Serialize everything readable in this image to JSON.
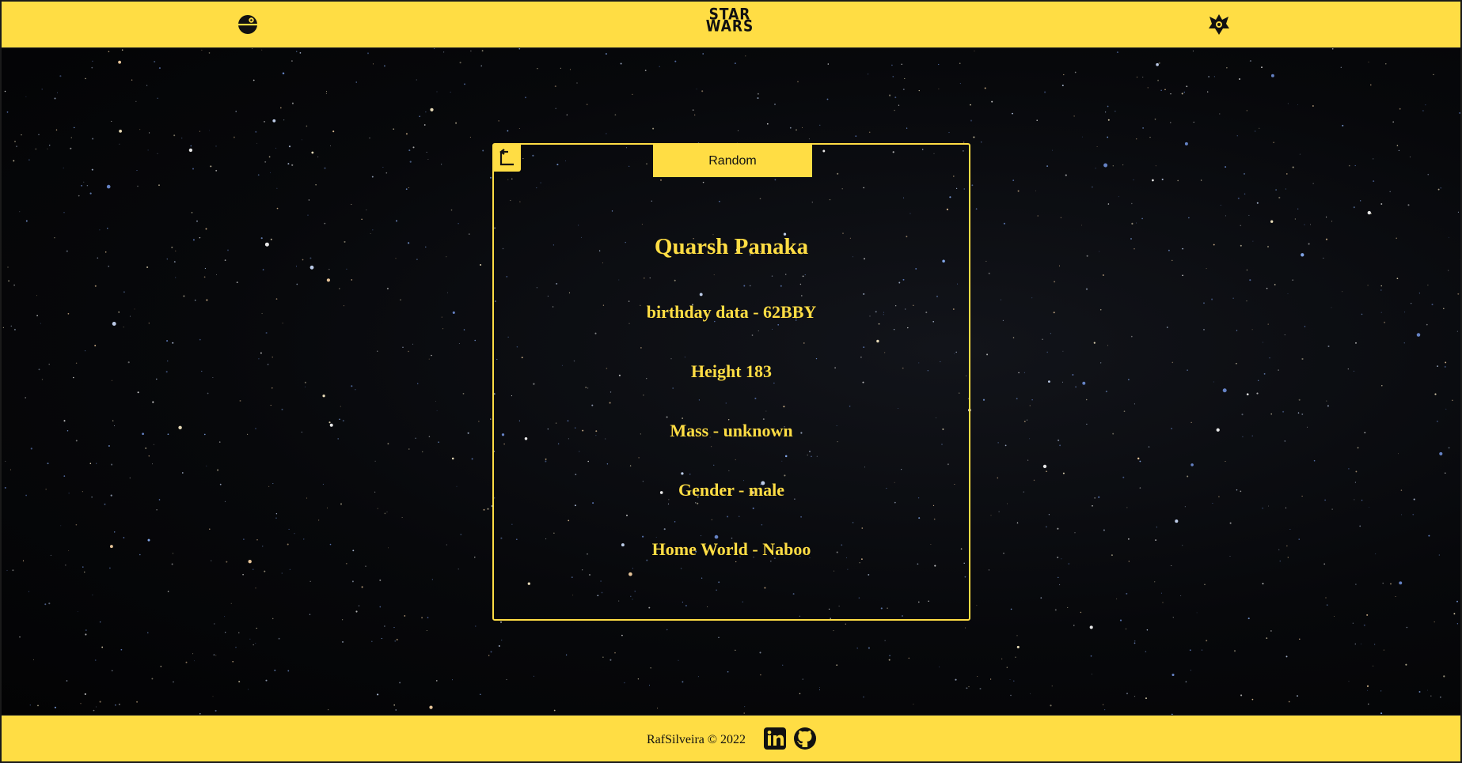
{
  "header": {
    "logo_line1": "STAR",
    "logo_line2": "WARS",
    "left_icon": "death-star-icon",
    "right_icon": "galactic-empire-icon"
  },
  "card": {
    "back_icon": "return-arrow-icon",
    "random_label": "Random",
    "name": "Quarsh Panaka",
    "birthday": "birthday data - 62BBY",
    "height": "Height 183",
    "mass": "Mass - unknown",
    "gender": "Gender - male",
    "homeworld": "Home World - Naboo"
  },
  "footer": {
    "credit": "RafSilveira © 2022",
    "linkedin_icon": "linkedin-icon",
    "github_icon": "github-icon"
  },
  "colors": {
    "accent": "#ffdd44",
    "background": "#000000",
    "dark": "#111111"
  }
}
